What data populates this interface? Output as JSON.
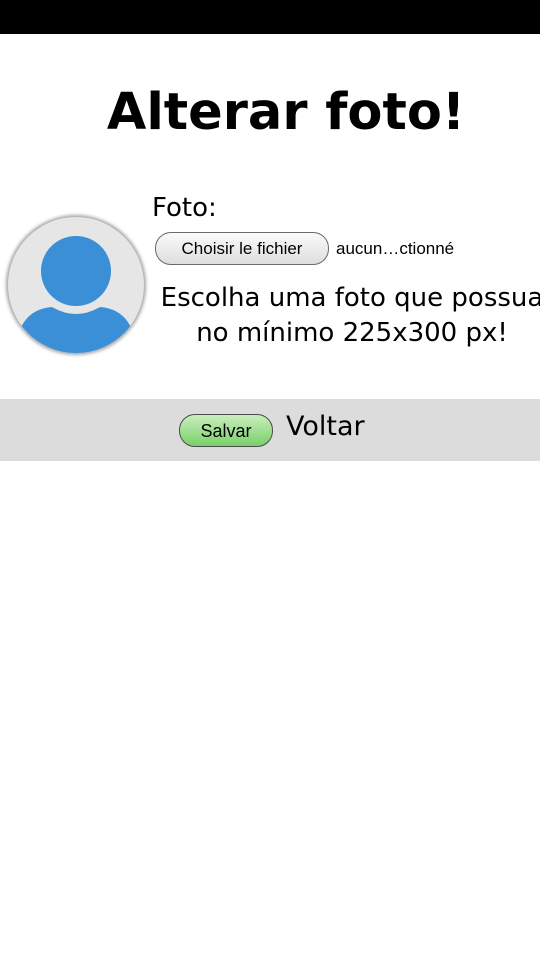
{
  "page": {
    "title": "Alterar foto!"
  },
  "form": {
    "photo_label": "Foto:",
    "file_button_label": "Choisir le fichier",
    "file_status": "aucun…ctionné",
    "hint_line1": "Escolha uma foto que possua",
    "hint_line2": "no mínimo 225x300 px!"
  },
  "actions": {
    "save_label": "Salvar",
    "back_label": "Voltar"
  },
  "avatar": {
    "icon": "user-silhouette-icon",
    "bg_color": "#e6e6e6",
    "figure_color": "#3a8fd6"
  },
  "colors": {
    "status_bar": "#000000",
    "action_bar": "#dcdcdc",
    "save_button": "#79d06a"
  }
}
